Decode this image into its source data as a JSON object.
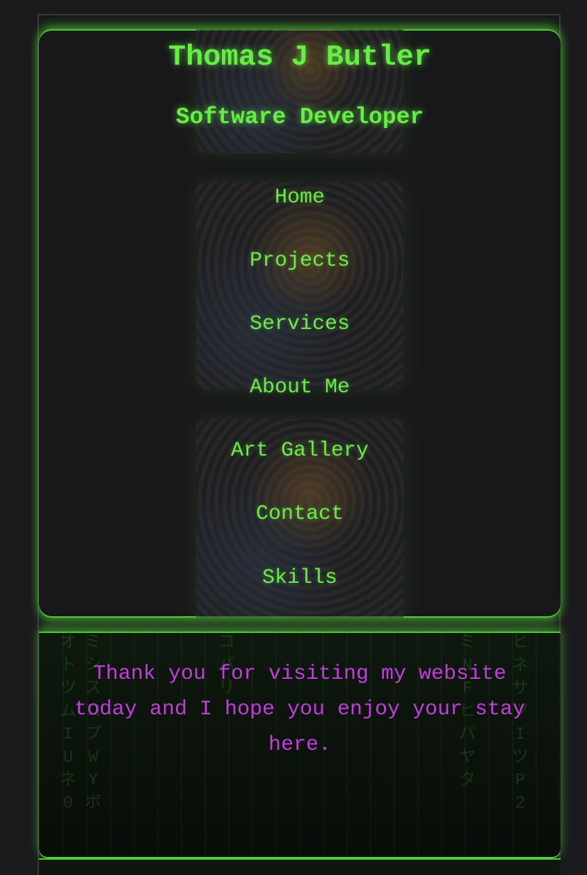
{
  "header": {
    "name": "Thomas J Butler",
    "role": "Software Developer"
  },
  "nav": {
    "items": [
      {
        "label": "Home"
      },
      {
        "label": "Projects"
      },
      {
        "label": "Services"
      },
      {
        "label": "About Me"
      },
      {
        "label": "Art Gallery"
      },
      {
        "label": "Contact"
      },
      {
        "label": "Skills"
      }
    ]
  },
  "footer": {
    "message": "Thank you for visiting my website today and I hope you enjoy your stay here."
  },
  "colors": {
    "accent_green": "#66ee44",
    "message_magenta": "#c43ce0",
    "background": "#18181a"
  }
}
